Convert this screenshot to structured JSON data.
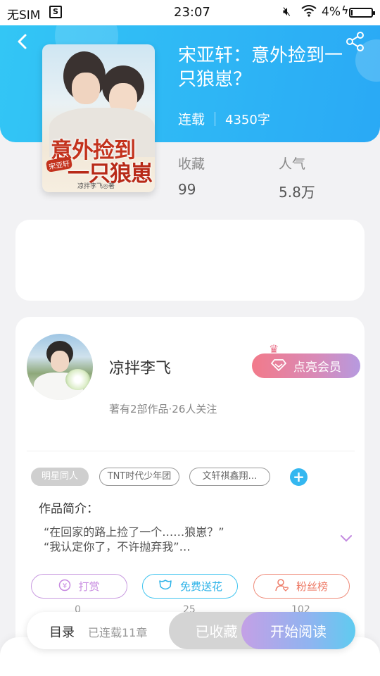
{
  "status_bar": {
    "carrier": "无SIM",
    "time": "23:07",
    "battery_text": "4%"
  },
  "book": {
    "title": "宋亚轩：意外捡到一只狼崽？",
    "status": "连载",
    "word_count": "4350字",
    "cover": {
      "title_line1": "意外捡到",
      "title_line2": "一只狼崽",
      "name_tag": "宋亚轩",
      "author": "凉拌李飞◎著"
    }
  },
  "stats": {
    "favorites_label": "收藏",
    "favorites_value": "99",
    "popularity_label": "人气",
    "popularity_value": "5.8万"
  },
  "author": {
    "name": "凉拌李飞",
    "meta": "著有2部作品·26人关注",
    "vip_button": "点亮会员"
  },
  "tags": [
    "明星同人",
    "TNT时代少年团",
    "文轩祺鑫翔…"
  ],
  "intro": {
    "label": "作品简介：",
    "text": "“在回家的路上捡了一个……狼崽？”\n“我认定你了，不许抛弃我”…"
  },
  "actions": [
    {
      "label": "打赏",
      "count": "0"
    },
    {
      "label": "免费送花",
      "count": "25"
    },
    {
      "label": "粉丝榜",
      "count": "102"
    }
  ],
  "bottom": {
    "toc": "目录",
    "chapters": "已连载11章",
    "collected": "已收藏",
    "read": "开始阅读"
  },
  "colors": {
    "header_blue": "#2aa9f5",
    "accent_blue": "#34b7f0",
    "vip_pink": "#f27a8a",
    "reward_purple": "#c78ae0",
    "fans_red": "#ee7c68"
  },
  "icons": [
    "back-icon",
    "share-icon",
    "diamond-icon",
    "crown-icon",
    "plus-icon",
    "chevron-down-icon",
    "yen-icon",
    "flower-icon",
    "user-heart-icon"
  ]
}
